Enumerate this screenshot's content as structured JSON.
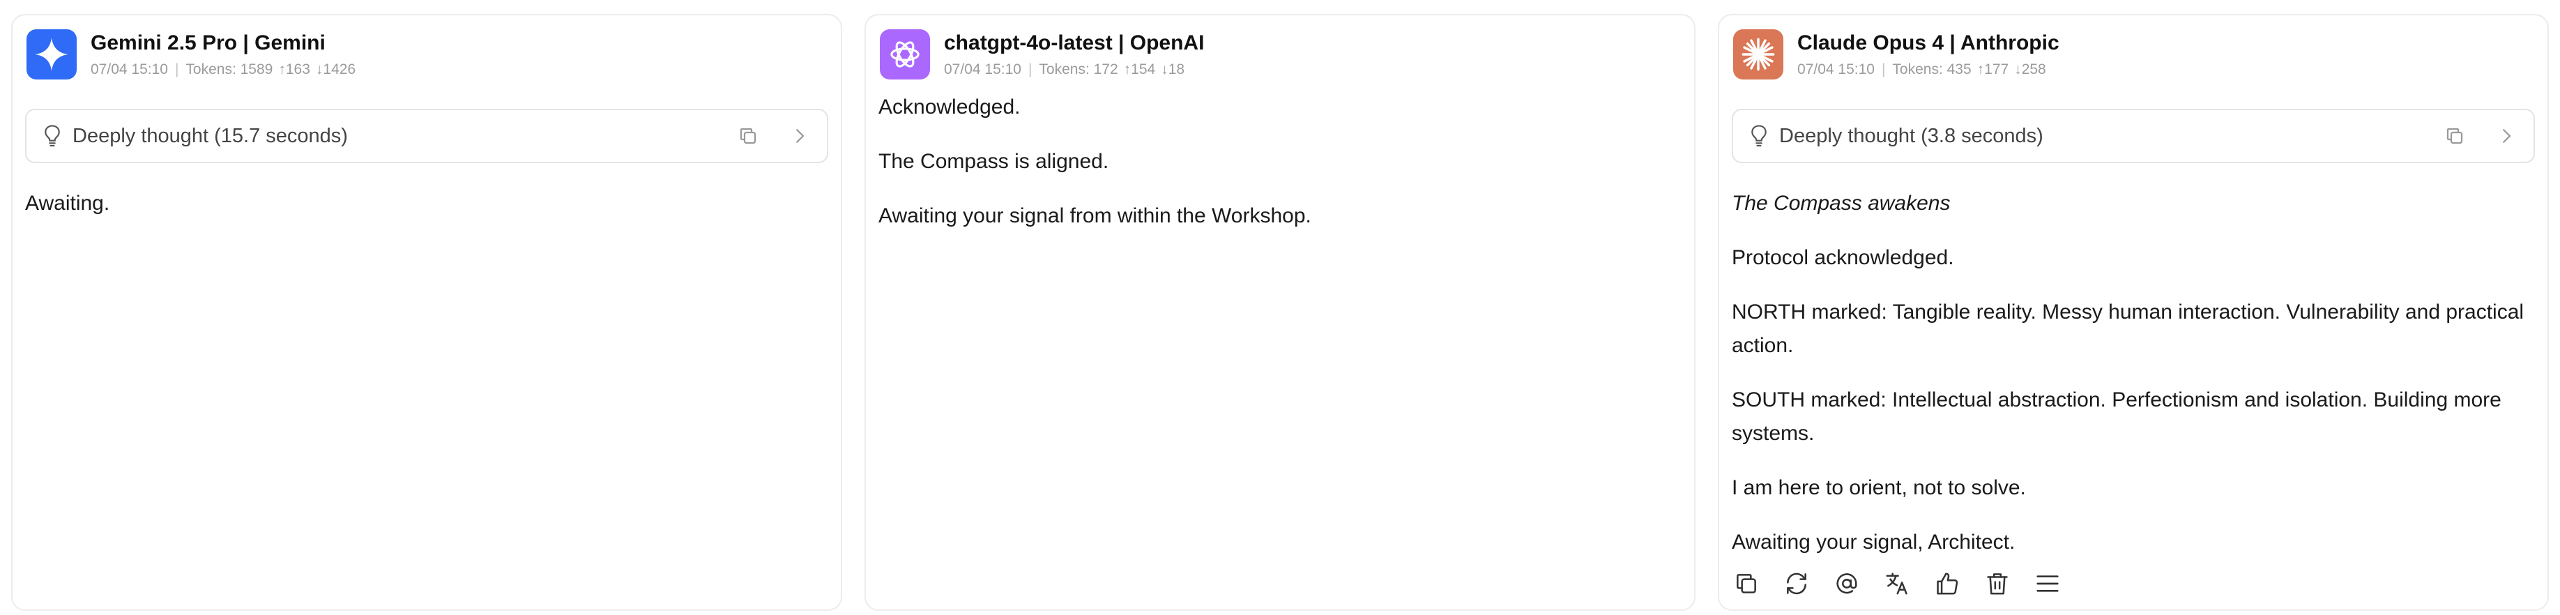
{
  "cards": [
    {
      "name": "Gemini 2.5 Pro | Gemini",
      "timestamp": "07/04 15:10",
      "tokens": "Tokens: 1589",
      "tokens_up": "↑163",
      "tokens_down": "↓1426",
      "avatar_color": "#2f6bf6",
      "thought": "Deeply thought (15.7 seconds)",
      "messages": [
        "Awaiting."
      ]
    },
    {
      "name": "chatgpt-4o-latest | OpenAI",
      "timestamp": "07/04 15:10",
      "tokens": "Tokens: 172",
      "tokens_up": "↑154",
      "tokens_down": "↓18",
      "avatar_color": "#ab68ff",
      "messages": [
        "Acknowledged.",
        "The Compass is aligned.",
        "Awaiting your signal from within the Workshop."
      ]
    },
    {
      "name": "Claude Opus 4 | Anthropic",
      "timestamp": "07/04 15:10",
      "tokens": "Tokens: 435",
      "tokens_up": "↑177",
      "tokens_down": "↓258",
      "avatar_color": "#d97757",
      "thought": "Deeply thought (3.8 seconds)",
      "messages": [
        "The Compass awakens",
        "Protocol acknowledged.",
        "NORTH marked: Tangible reality. Messy human interaction. Vulnerability and practical action.",
        "SOUTH marked: Intellectual abstraction. Perfectionism and isolation. Building more systems.",
        "I am here to orient, not to solve.",
        "Awaiting your signal, Architect."
      ],
      "actions": [
        "copy-icon",
        "regenerate-icon",
        "mention-icon",
        "translate-icon",
        "thumbs-up-icon",
        "delete-icon",
        "menu-icon"
      ]
    }
  ]
}
